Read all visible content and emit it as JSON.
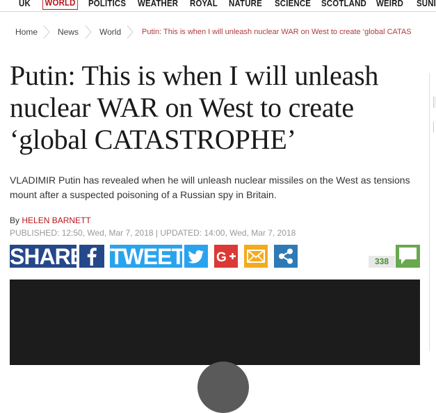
{
  "nav": {
    "items": [
      {
        "label": "UK",
        "active": false
      },
      {
        "label": "WORLD",
        "active": true
      },
      {
        "label": "POLITICS",
        "active": false
      },
      {
        "label": "WEATHER",
        "active": false
      },
      {
        "label": "ROYAL",
        "active": false
      },
      {
        "label": "NATURE",
        "active": false
      },
      {
        "label": "SCIENCE",
        "active": false
      },
      {
        "label": "SCOTLAND",
        "active": false
      },
      {
        "label": "WEIRD",
        "active": false
      },
      {
        "label": "SUNI",
        "active": false
      }
    ]
  },
  "breadcrumb": {
    "home": "Home",
    "news": "News",
    "world": "World",
    "current": "Putin: This is when I will unleash nuclear WAR on West to create ‘global CATAS"
  },
  "article": {
    "headline": "Putin: This is when I will unleash nuclear WAR on West to create ‘global CATASTROPHE’",
    "standfirst": "VLADIMIR Putin has revealed when he will unleash nuclear missiles on the West as tensions mount after a suspected poisoning of a Russian spy in Britain.",
    "by_prefix": "By",
    "author": "HELEN BARNETT",
    "published": "PUBLISHED: 12:50, Wed, Mar 7, 2018 | UPDATED: 14:00, Wed, Mar 7, 2018"
  },
  "share": {
    "share_label": "SHARE",
    "tweet_label": "TWEET",
    "comment_count": "338",
    "icons": [
      "facebook-icon",
      "twitter-icon",
      "google-plus-icon",
      "email-icon",
      "share-icon",
      "comment-icon"
    ]
  },
  "colors": {
    "accent_red": "#b8161b",
    "facebook": "#25488a",
    "twitter": "#2aa3ef",
    "google_plus": "#db3936",
    "email": "#f3ab1c",
    "share": "#2f7ab5",
    "comment": "#6aa84f"
  }
}
